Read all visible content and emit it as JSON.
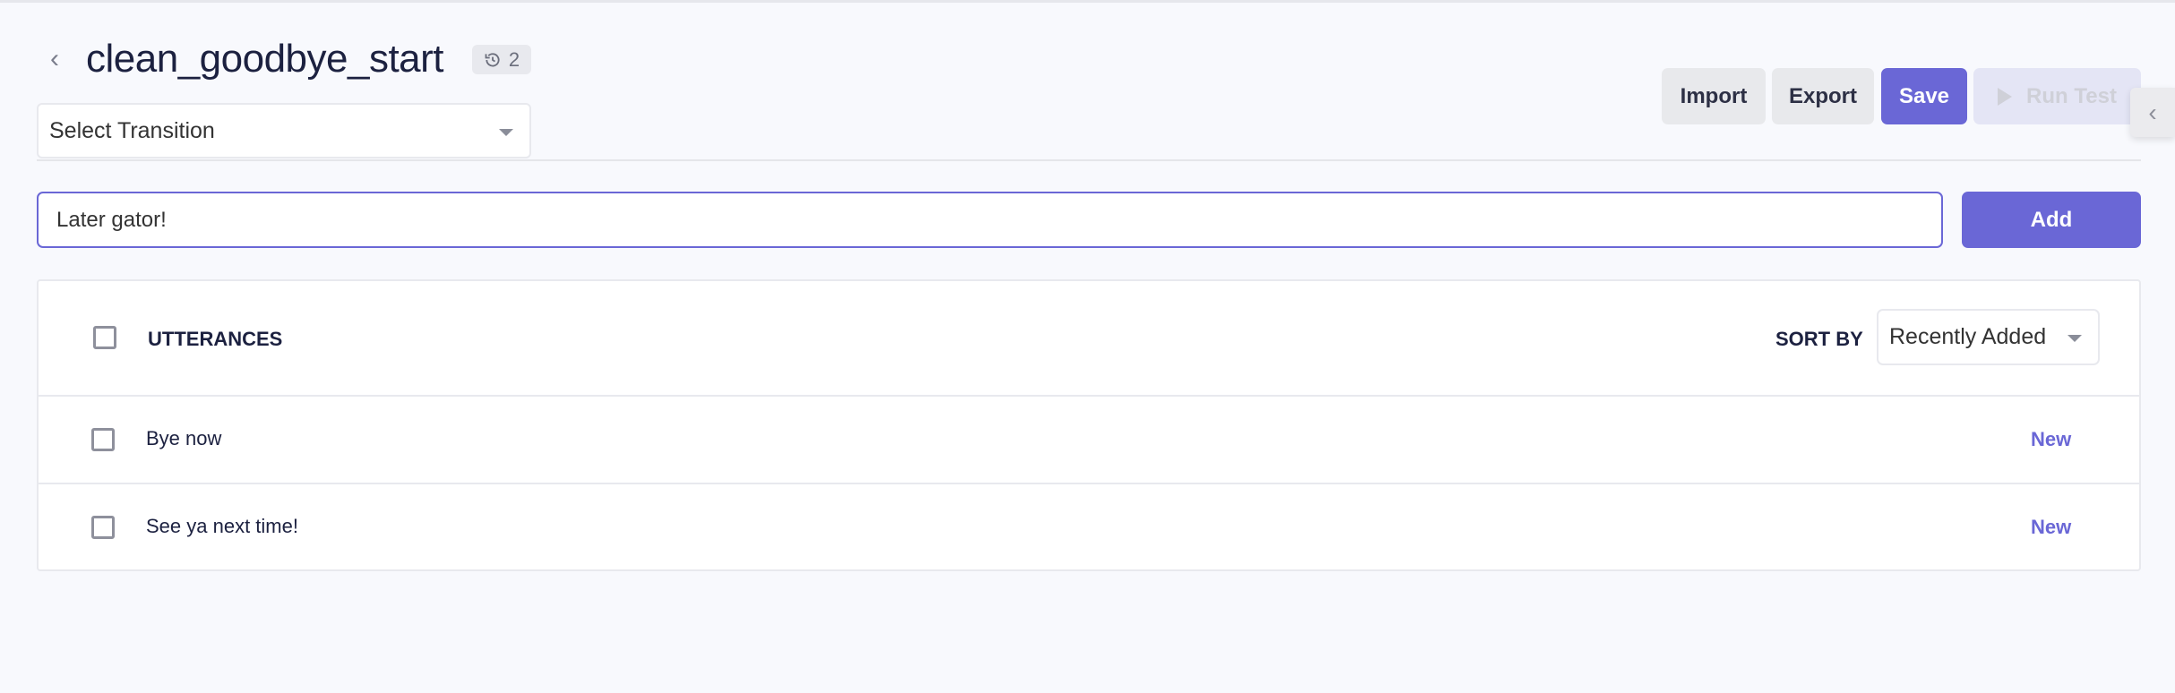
{
  "header": {
    "title": "clean_goodbye_start",
    "history_count": "2",
    "back_icon": "chevron-left-icon",
    "history_icon": "history-icon"
  },
  "transition_select": {
    "value": "Select Transition"
  },
  "toolbar": {
    "import": "Import",
    "export": "Export",
    "save": "Save",
    "run_test": "Run Test"
  },
  "utterance_input": {
    "value": "Later gator!"
  },
  "add_label": "Add",
  "table": {
    "header": "UTTERANCES",
    "sort_label": "SORT BY",
    "sort_value": "Recently Added",
    "rows": [
      {
        "text": "Bye now",
        "status": "New"
      },
      {
        "text": "See ya next time!",
        "status": "New"
      }
    ]
  },
  "colors": {
    "accent": "#6a67d6",
    "background": "#f8f9fd",
    "text": "#1c2140"
  }
}
